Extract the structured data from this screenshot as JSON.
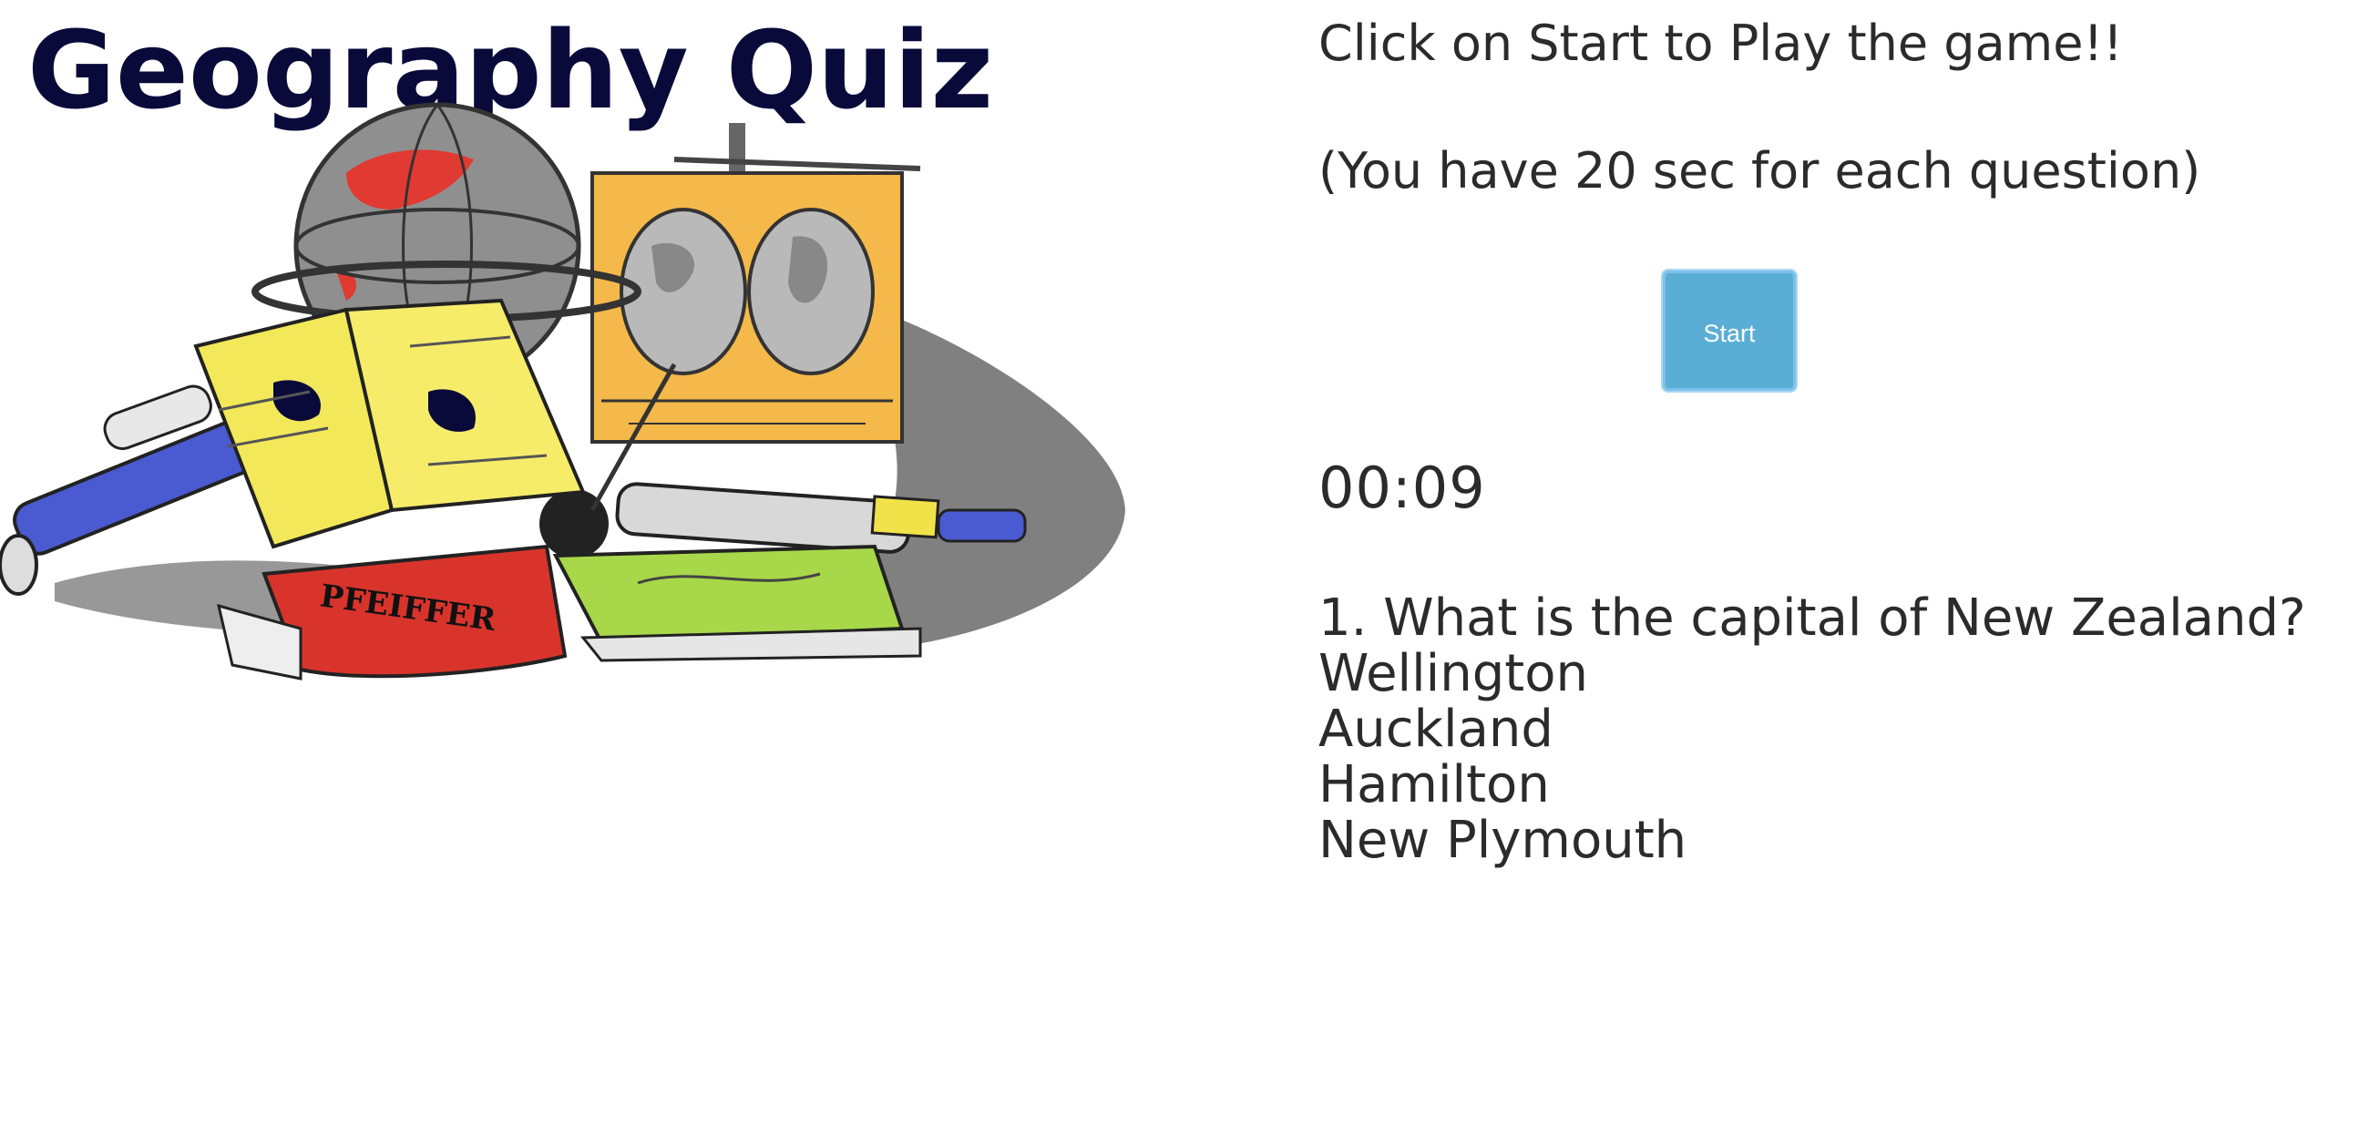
{
  "banner": {
    "title": "Geography Quiz",
    "book_stamp": "PFEIFFER"
  },
  "quiz": {
    "instructions": "Click on Start to Play the game!!",
    "time_note": "(You have 20 sec for each question)",
    "start_label": "Start",
    "timer": "00:09",
    "question": "1. What is the capital of New Zealand?",
    "options": [
      "Wellington",
      "Auckland",
      "Hamilton",
      "New Plymouth"
    ]
  },
  "colors": {
    "title": "#0a0a3a",
    "button": "#5aaed6",
    "text": "#2b2b2b"
  }
}
